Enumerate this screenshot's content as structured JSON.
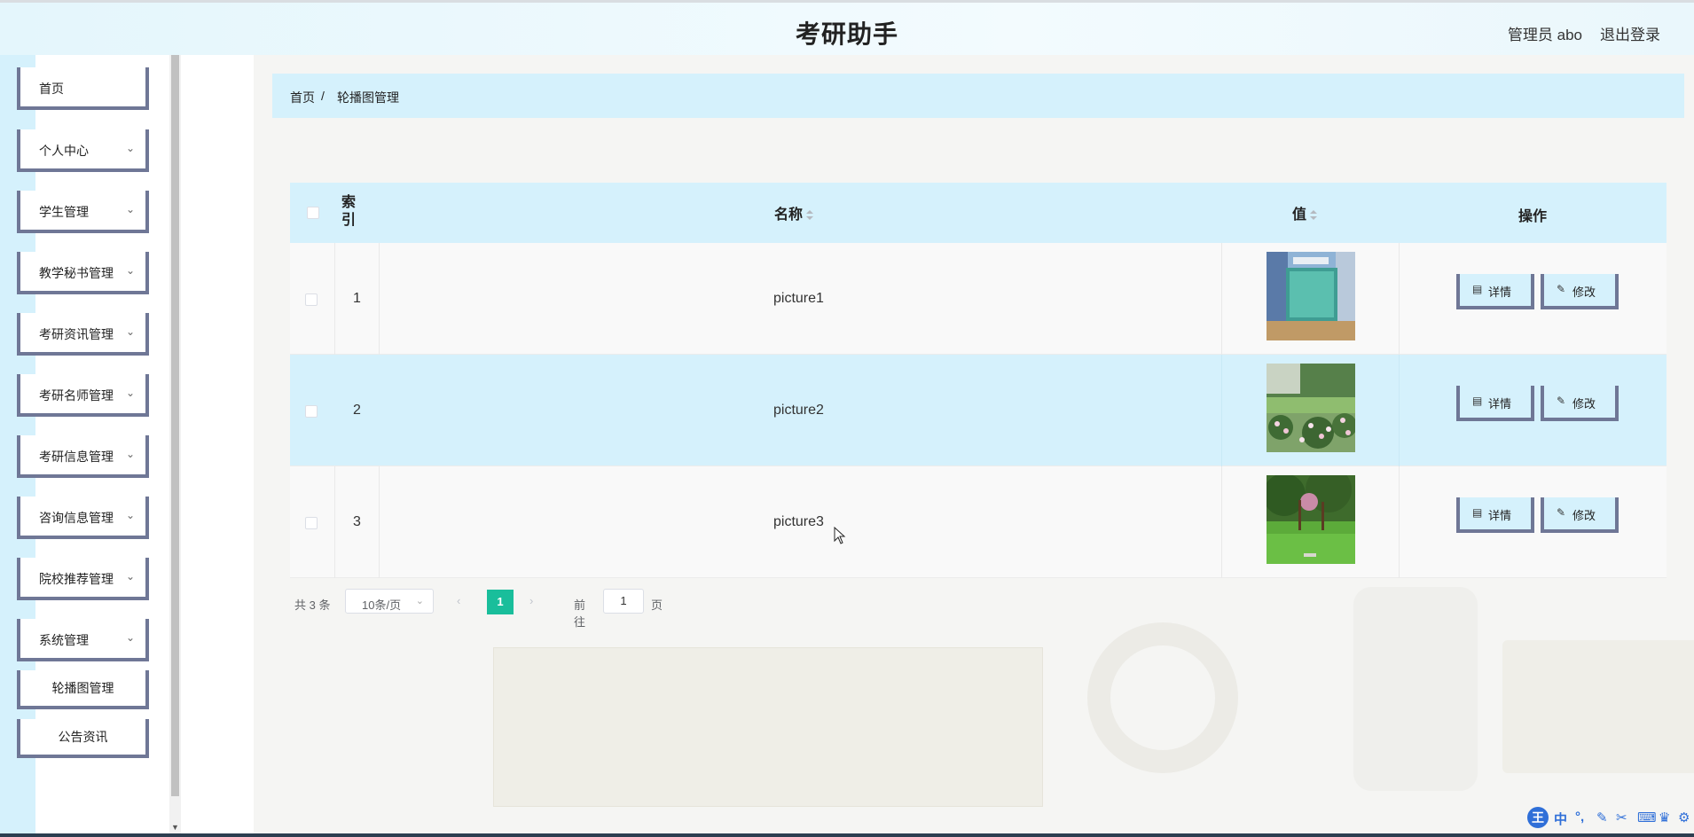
{
  "header": {
    "title": "考研助手",
    "user": "管理员 abo",
    "logout": "退出登录"
  },
  "sidebar": {
    "items": [
      {
        "label": "首页",
        "expandable": false
      },
      {
        "label": "个人中心",
        "expandable": true
      },
      {
        "label": "学生管理",
        "expandable": true
      },
      {
        "label": "教学秘书管理",
        "expandable": true
      },
      {
        "label": "考研资讯管理",
        "expandable": true
      },
      {
        "label": "考研名师管理",
        "expandable": true
      },
      {
        "label": "考研信息管理",
        "expandable": true
      },
      {
        "label": "咨询信息管理",
        "expandable": true
      },
      {
        "label": "院校推荐管理",
        "expandable": true
      },
      {
        "label": "系统管理",
        "expandable": true
      }
    ],
    "subitems": [
      {
        "label": "轮播图管理"
      },
      {
        "label": "公告资讯"
      }
    ]
  },
  "breadcrumb": {
    "home": "首页",
    "separator": "/",
    "current": "轮播图管理"
  },
  "table": {
    "headers": {
      "index": "索引",
      "name": "名称",
      "value": "值",
      "actions": "操作"
    },
    "rows": [
      {
        "index": "1",
        "name": "picture1",
        "thumb": "classroom-photo"
      },
      {
        "index": "2",
        "name": "picture2",
        "thumb": "flower-garden-photo"
      },
      {
        "index": "3",
        "name": "picture3",
        "thumb": "lawn-trees-photo"
      }
    ],
    "detail_label": "详情",
    "edit_label": "修改"
  },
  "pagination": {
    "total": "共 3 条",
    "page_size": "10条/页",
    "current_page": "1",
    "goto_label": "前往",
    "goto_value": "1",
    "page_unit": "页"
  },
  "tray": {
    "ime": "王",
    "lang": "中"
  },
  "colors": {
    "accent_light_blue": "#d5f1fc",
    "button_border": "#6f7796",
    "active_page": "#19be9b"
  }
}
